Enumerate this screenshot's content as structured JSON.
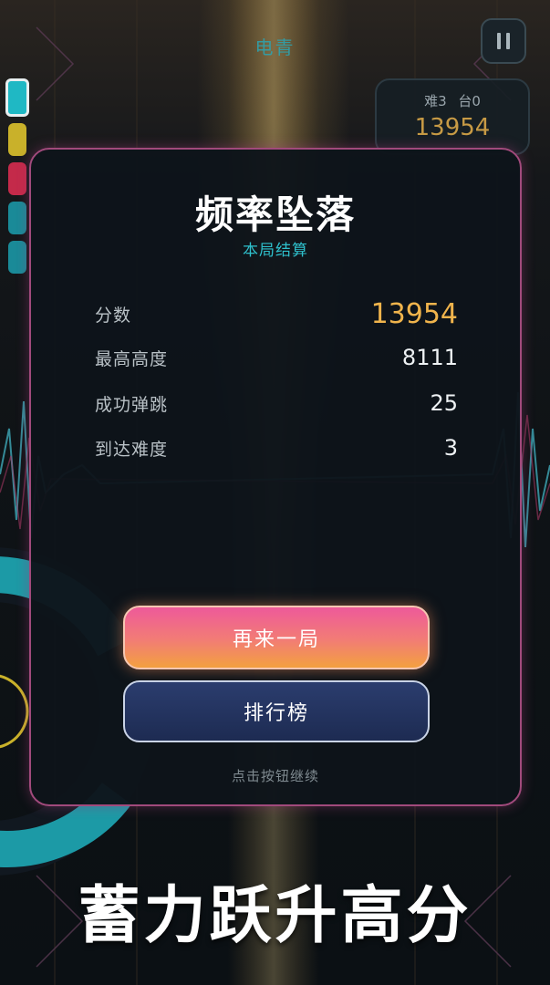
{
  "hud": {
    "mode_label": "电青",
    "difficulty_label": "难3",
    "platform_label": "台0",
    "score": "13954"
  },
  "color_strip": [
    {
      "color": "#1fb8c4",
      "active": true
    },
    {
      "color": "#c9b12a",
      "active": false
    },
    {
      "color": "#c42a4a",
      "active": false
    },
    {
      "color": "#1a8a98",
      "active": false
    },
    {
      "color": "#1a8a98",
      "active": false
    }
  ],
  "result_panel": {
    "title": "频率坠落",
    "subtitle": "本局结算",
    "stats": [
      {
        "label": "分数",
        "value": "13954"
      },
      {
        "label": "最高高度",
        "value": "8111"
      },
      {
        "label": "成功弹跳",
        "value": "25"
      },
      {
        "label": "到达难度",
        "value": "3"
      }
    ],
    "play_again_label": "再来一局",
    "leaderboard_label": "排行榜",
    "hint": "点击按钮继续"
  },
  "banner": "蓄力跃升高分",
  "colors": {
    "accent_cyan": "#2ec0cc",
    "score_gold": "#f0b44c",
    "panel_border": "#a14a7c"
  },
  "icons": {
    "pause": "pause-icon"
  }
}
